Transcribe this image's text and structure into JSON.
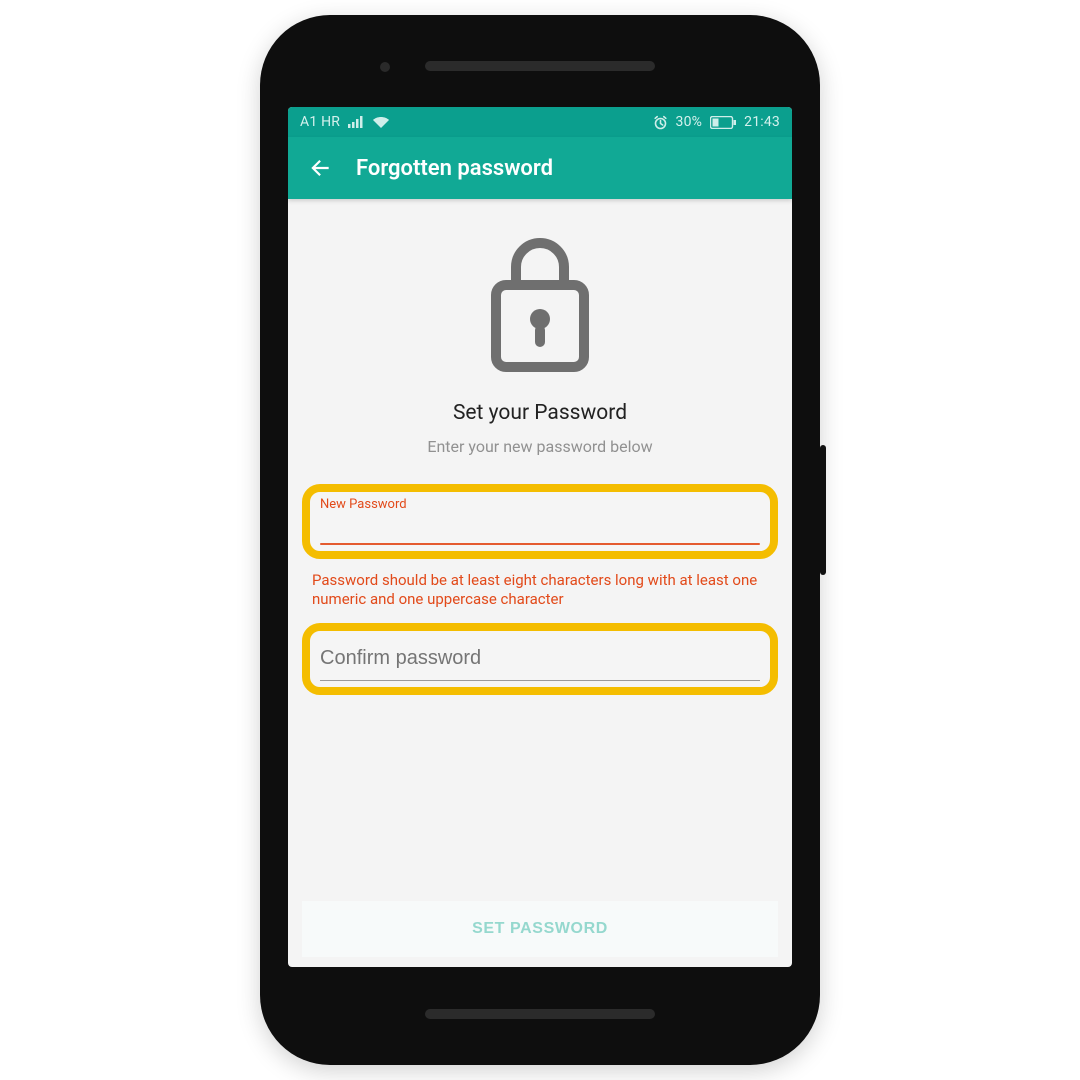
{
  "statusbar": {
    "carrier": "A1 HR",
    "battery_percent": "30%",
    "clock": "21:43"
  },
  "titlebar": {
    "title": "Forgotten password"
  },
  "main": {
    "heading": "Set your Password",
    "subheading": "Enter your new password below",
    "new_password": {
      "label": "New Password",
      "value": "",
      "error": "Password should be at least eight characters long with at least one numeric and one uppercase character"
    },
    "confirm_password": {
      "placeholder": "Confirm password",
      "value": ""
    },
    "submit_label": "SET PASSWORD"
  },
  "colors": {
    "accent": "#11a995",
    "highlight": "#f4bd00",
    "error": "#e24a1a"
  }
}
